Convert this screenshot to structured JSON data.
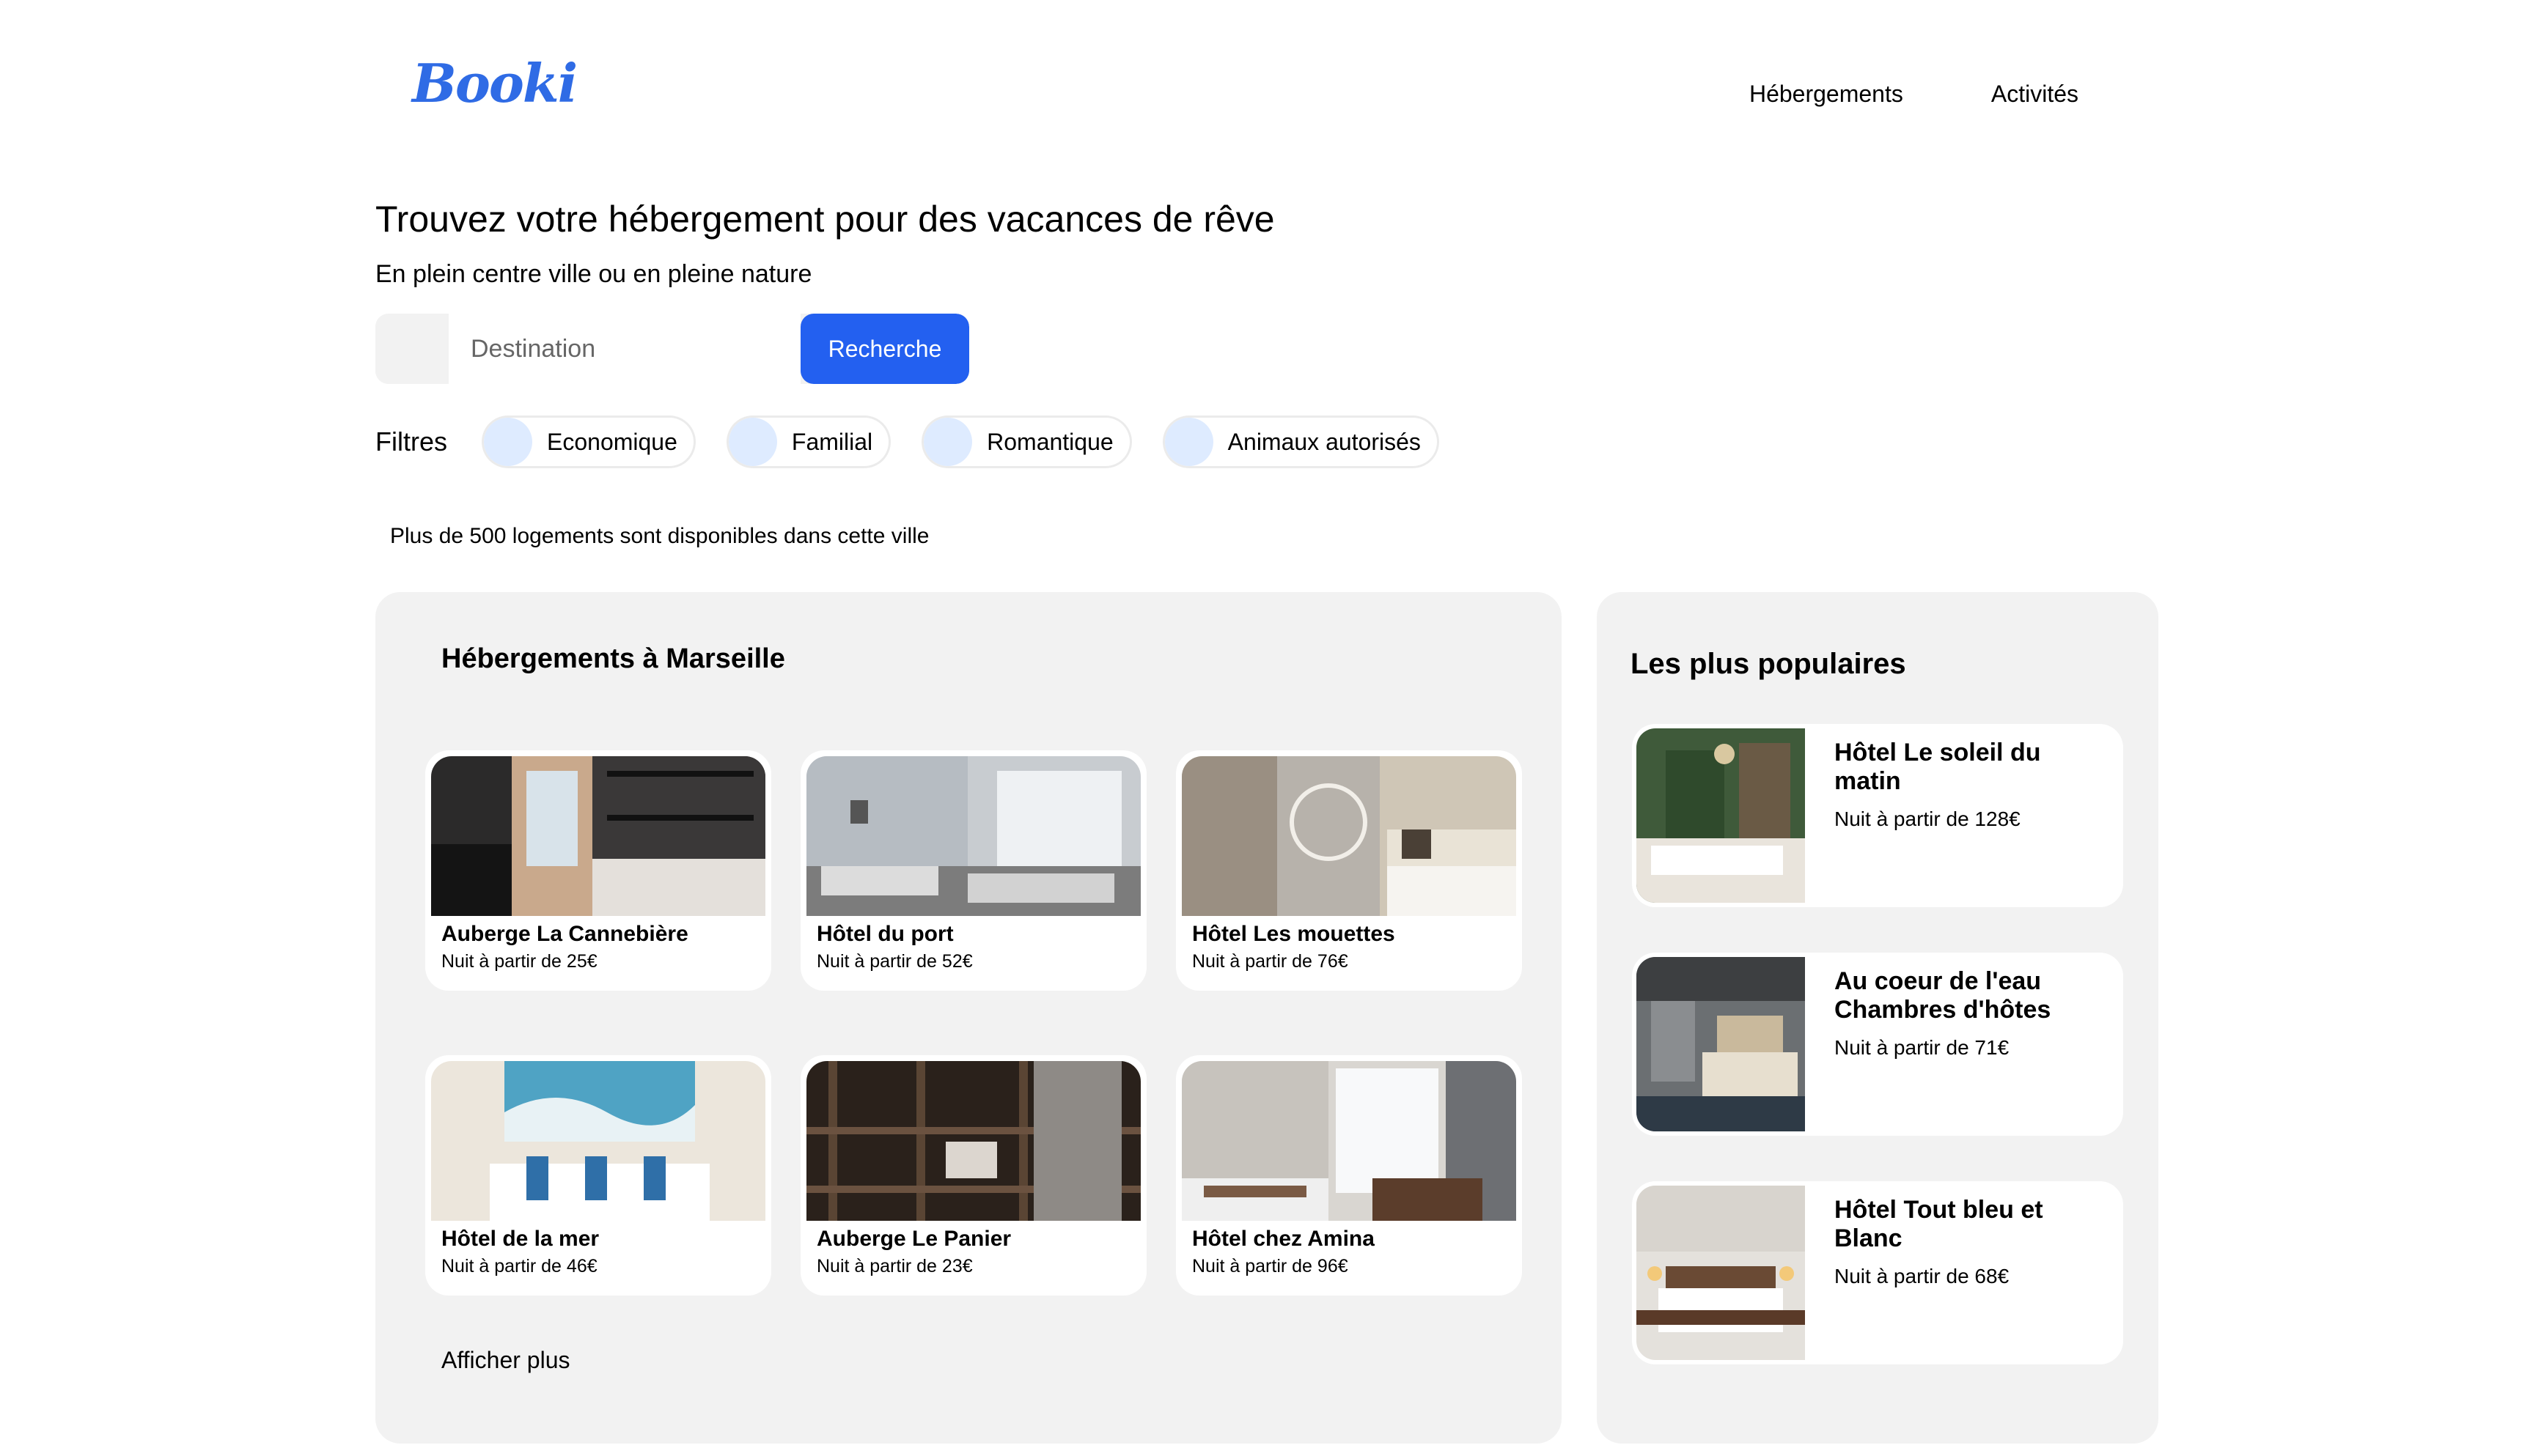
{
  "header": {
    "logo": "Booki",
    "nav": [
      "Hébergements",
      "Activités"
    ]
  },
  "hero": {
    "title": "Trouvez votre hébergement pour des vacances de rêve",
    "subtitle": "En plein centre ville ou en pleine nature"
  },
  "search": {
    "placeholder": "Destination",
    "button_label": "Recherche"
  },
  "filters": {
    "label": "Filtres",
    "items": [
      "Economique",
      "Familial",
      "Romantique",
      "Animaux autorisés"
    ]
  },
  "info_line": "Plus de 500 logements sont disponibles dans cette ville",
  "accommodations": {
    "title": "Hébergements à Marseille",
    "items": [
      {
        "name": "Auberge La Cannebière",
        "price": "Nuit à partir de 25€"
      },
      {
        "name": "Hôtel du port",
        "price": "Nuit à partir de 52€"
      },
      {
        "name": "Hôtel Les mouettes",
        "price": "Nuit à partir de 76€"
      },
      {
        "name": "Hôtel de la mer",
        "price": "Nuit à partir de 46€"
      },
      {
        "name": "Auberge Le Panier",
        "price": "Nuit à partir de 23€"
      },
      {
        "name": "Hôtel chez Amina",
        "price": "Nuit à partir de 96€"
      }
    ],
    "show_more": "Afficher plus"
  },
  "popular": {
    "title": "Les plus populaires",
    "items": [
      {
        "name": "Hôtel Le soleil du matin",
        "price": "Nuit à partir de 128€"
      },
      {
        "name": "Au coeur de l'eau Chambres d'hôtes",
        "price": "Nuit à partir de 71€"
      },
      {
        "name": "Hôtel Tout bleu et Blanc",
        "price": "Nuit à partir de 68€"
      }
    ]
  },
  "colors": {
    "brand": "#2F6BE5",
    "button": "#2360F0",
    "panel": "#F2F2F2",
    "filter_icon": "#DEEBFF"
  }
}
